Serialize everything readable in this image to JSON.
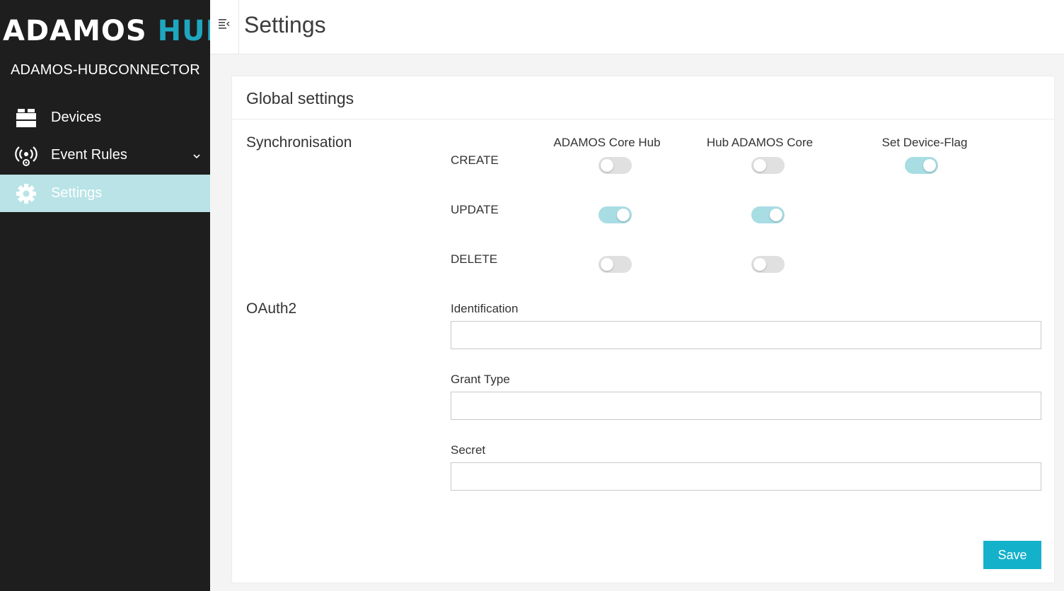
{
  "brand": {
    "logo_primary": "ADAMOS",
    "logo_accent": "HUB",
    "app_name": "ADAMOS-HUBCONNECTOR",
    "accent_color": "#1ea7be"
  },
  "sidebar": {
    "items": [
      {
        "label": "Devices",
        "icon": "devices-icon",
        "active": false
      },
      {
        "label": "Event Rules",
        "icon": "event-rules-icon",
        "active": false,
        "expandable": true
      },
      {
        "label": "Settings",
        "icon": "gear-icon",
        "active": true
      }
    ]
  },
  "header": {
    "title": "Settings"
  },
  "card": {
    "title": "Global settings",
    "synchronisation": {
      "title": "Synchronisation",
      "columns": [
        "ADAMOS Core Hub",
        "Hub ADAMOS Core",
        "Set Device-Flag"
      ],
      "rows": [
        {
          "label": "CREATE",
          "toggles": [
            false,
            false,
            true
          ]
        },
        {
          "label": "UPDATE",
          "toggles": [
            true,
            true
          ]
        },
        {
          "label": "DELETE",
          "toggles": [
            false,
            false
          ]
        }
      ]
    },
    "oauth2": {
      "title": "OAuth2",
      "fields": [
        {
          "label": "Identification",
          "value": ""
        },
        {
          "label": "Grant Type",
          "value": ""
        },
        {
          "label": "Secret",
          "value": ""
        }
      ]
    },
    "save_label": "Save"
  },
  "colors": {
    "sidebar_bg": "#1e1e1e",
    "active_item_bg": "#b9e3e6",
    "toggle_on": "#a8dde3",
    "toggle_off": "#e0e0e0",
    "button": "#14b1cb"
  }
}
